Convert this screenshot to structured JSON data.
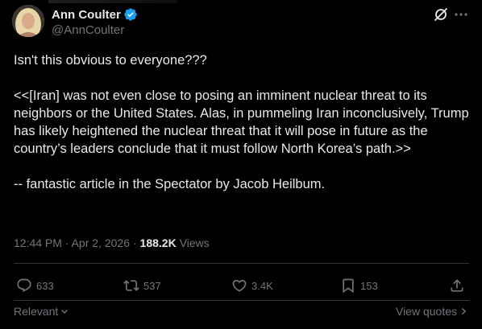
{
  "author": {
    "display_name": "Ann Coulter",
    "handle": "@AnnCoulter",
    "verified": true,
    "verified_color": "#1d9bf0"
  },
  "tweet": {
    "line1": "Isn't this obvious to everyone???",
    "line2": "<<[Iran] was not even close to posing an imminent nuclear threat to its neighbors or the United States. Alas, in pummeling Iran inconclusively, Trump has likely heightened the nuclear threat that it will pose in future as the country’s leaders conclude that it must follow North Korea’s path.>>",
    "line3": "-- fantastic article in the Spectator by Jacob Heilbum."
  },
  "meta": {
    "timestamp": "12:44 PM · Apr 2, 2026 · ",
    "views_count": "188.2K",
    "views_label": "Views"
  },
  "actions": {
    "replies": "633",
    "reposts": "537",
    "likes": "3.4K",
    "bookmarks": "153"
  },
  "footer": {
    "relevant": "Relevant",
    "view_quotes": "View quotes"
  },
  "icons": [
    "avatar",
    "verified-badge-icon",
    "grok-icon",
    "more-icon",
    "reply-icon",
    "repost-icon",
    "like-icon",
    "bookmark-icon",
    "share-icon",
    "chevron-down-icon",
    "chevron-right-icon"
  ],
  "colors": {
    "background": "#000000",
    "text": "#e7e9ea",
    "secondary": "#71767b",
    "divider": "#2f3336",
    "accent": "#1d9bf0"
  }
}
